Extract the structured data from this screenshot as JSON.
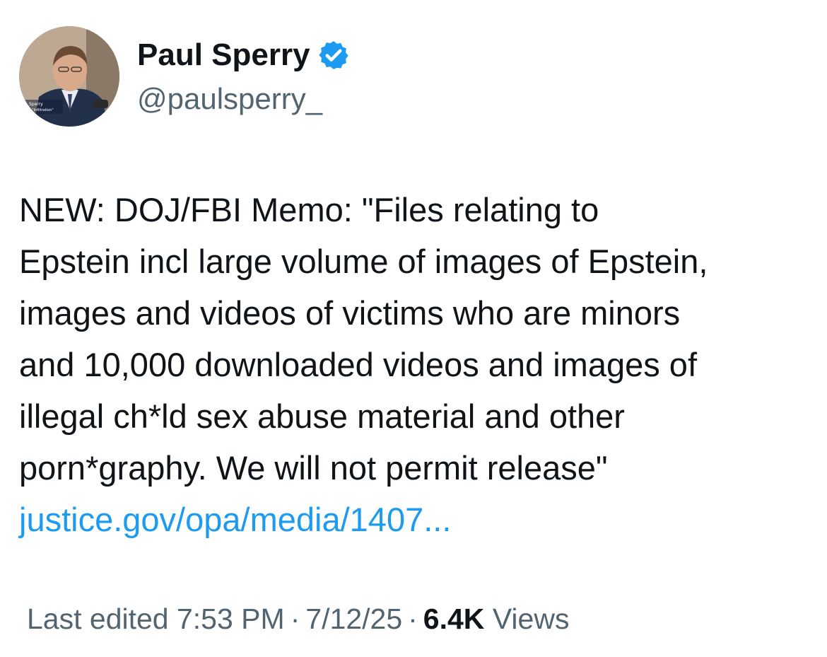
{
  "author": {
    "name": "Paul Sperry",
    "handle": "@paulsperry_",
    "verified_color": "#1d9bf0",
    "avatar_caption_line1": "Sperry",
    "avatar_caption_line2": "or, \"Infiltration\""
  },
  "tweet": {
    "lines": [
      "NEW: DOJ/FBI Memo: \"Files relating to",
      "Epstein incl large volume of images of Epstein,",
      "images and videos of victims who are minors",
      "and 10,000 downloaded videos and images of",
      "illegal ch*ld sex abuse material and other",
      "porn*graphy. We will not permit release\""
    ],
    "link_text": "justice.gov/opa/media/1407..."
  },
  "meta": {
    "edited_label": "Last edited 7:53 PM",
    "separator": "·",
    "date": "7/12/25",
    "views_count": "6.4K",
    "views_label": "Views"
  },
  "colors": {
    "text": "#0f1419",
    "secondary": "#536471",
    "link": "#1d9bf0"
  },
  "icons": {
    "verified": "verified-badge-icon"
  }
}
